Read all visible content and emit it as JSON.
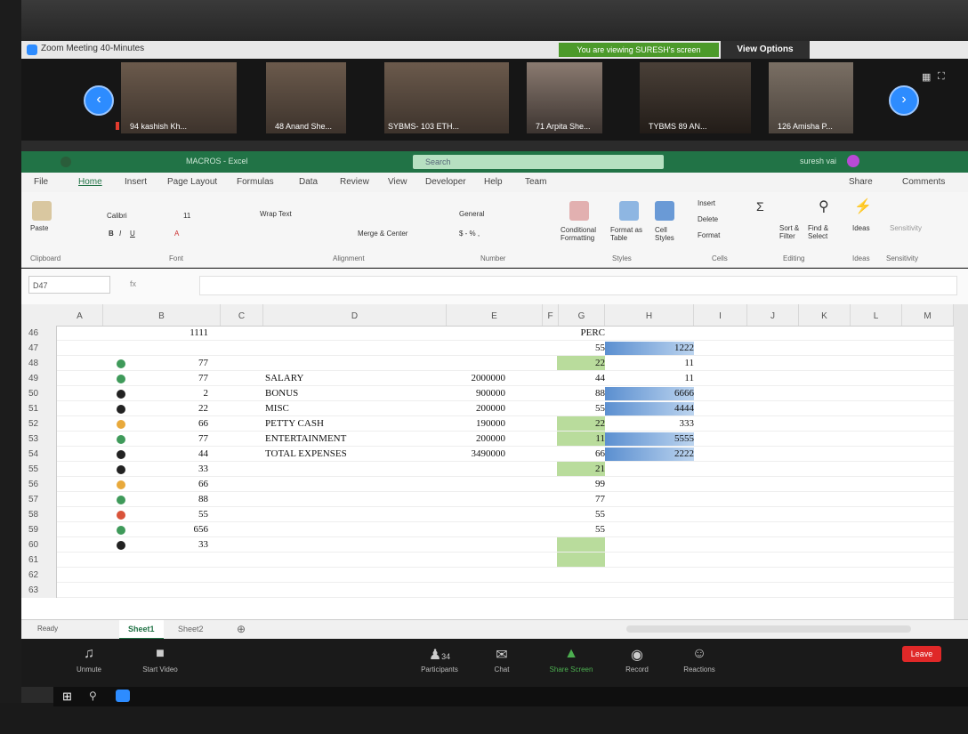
{
  "zoom": {
    "window_title": "Zoom Meeting 40-Minutes",
    "viewing_banner": "You are viewing SURESH's screen",
    "view_options": "View Options",
    "participants": [
      {
        "name": "94 kashish Kh..."
      },
      {
        "name": "48 Anand She..."
      },
      {
        "name": "SYBMS- 103 ETH..."
      },
      {
        "name": "71 Arpita She..."
      },
      {
        "name": "TYBMS 89 AN..."
      },
      {
        "name": "126 Amisha P..."
      }
    ],
    "toolbar": [
      {
        "label": "Unmute",
        "icon": "microphone-icon"
      },
      {
        "label": "Start Video",
        "icon": "video-camera-icon"
      },
      {
        "label": "Participants",
        "icon": "participants-icon"
      },
      {
        "label": "Chat",
        "icon": "chat-icon"
      },
      {
        "label": "Share Screen",
        "icon": "share-screen-icon"
      },
      {
        "label": "Record",
        "icon": "record-icon"
      },
      {
        "label": "Reactions",
        "icon": "reactions-icon"
      }
    ],
    "participants_count": "34",
    "leave_label": "Leave"
  },
  "excel": {
    "file_name": "MACROS - Excel",
    "search_placeholder": "Search",
    "user": "suresh vai",
    "tabs": [
      "File",
      "Home",
      "Insert",
      "Page Layout",
      "Formulas",
      "Data",
      "Review",
      "View",
      "Developer",
      "Help",
      "Team"
    ],
    "active_tab": "Home",
    "share_label": "Share",
    "comments_label": "Comments",
    "ribbon": {
      "paste": "Paste",
      "font_name": "Calibri",
      "font_size": "11",
      "wrap_text": "Wrap Text",
      "merge_center": "Merge & Center",
      "number_format": "General",
      "conditional_formatting": "Conditional Formatting",
      "format_as_table": "Format as Table",
      "cell_styles": "Cell Styles",
      "insert": "Insert",
      "delete": "Delete",
      "format": "Format",
      "sort_filter": "Sort & Filter",
      "find_select": "Find & Select",
      "ideas": "Ideas",
      "sensitivity": "Sensitivity",
      "groups": [
        "Clipboard",
        "Font",
        "Alignment",
        "Number",
        "Styles",
        "Cells",
        "Editing",
        "Ideas",
        "Sensitivity"
      ]
    },
    "name_box": "D47",
    "fx": "fx",
    "columns": [
      "A",
      "B",
      "C",
      "D",
      "E",
      "F",
      "G",
      "H",
      "I",
      "J",
      "K",
      "L",
      "M"
    ],
    "rows": [
      {
        "n": "46",
        "b": "1111",
        "dot": "",
        "d": "",
        "e": "",
        "g": "PERC",
        "g_fill": false,
        "h": "",
        "h_bar": 0
      },
      {
        "n": "47",
        "b": "",
        "dot": "",
        "d": "",
        "e": "",
        "g": "55",
        "g_fill": false,
        "h": "1222",
        "h_bar": 1.0
      },
      {
        "n": "48",
        "b": "77",
        "dot": "#3f9a5a",
        "d": "",
        "e": "",
        "g": "22",
        "g_fill": true,
        "h": "11",
        "h_bar": 0
      },
      {
        "n": "49",
        "b": "77",
        "dot": "#3f9a5a",
        "d": "SALARY",
        "e": "2000000",
        "g": "44",
        "g_fill": false,
        "h": "11",
        "h_bar": 0
      },
      {
        "n": "50",
        "b": "2",
        "dot": "#222222",
        "d": "BONUS",
        "e": "900000",
        "g": "88",
        "g_fill": false,
        "h": "6666",
        "h_bar": 1.0
      },
      {
        "n": "51",
        "b": "22",
        "dot": "#222222",
        "d": "MISC",
        "e": "200000",
        "g": "55",
        "g_fill": false,
        "h": "4444",
        "h_bar": 1.0
      },
      {
        "n": "52",
        "b": "66",
        "dot": "#e8a93b",
        "d": "PETTY CASH",
        "e": "190000",
        "g": "22",
        "g_fill": true,
        "h": "333",
        "h_bar": 0
      },
      {
        "n": "53",
        "b": "77",
        "dot": "#3f9a5a",
        "d": "ENTERTAINMENT",
        "e": "200000",
        "g": "11",
        "g_fill": true,
        "h": "5555",
        "h_bar": 1.0
      },
      {
        "n": "54",
        "b": "44",
        "dot": "#222222",
        "d": "TOTAL EXPENSES",
        "e": "3490000",
        "g": "66",
        "g_fill": false,
        "h": "2222",
        "h_bar": 1.0
      },
      {
        "n": "55",
        "b": "33",
        "dot": "#222222",
        "d": "",
        "e": "",
        "g": "21",
        "g_fill": true,
        "h": "",
        "h_bar": 0
      },
      {
        "n": "56",
        "b": "66",
        "dot": "#e8a93b",
        "d": "",
        "e": "",
        "g": "99",
        "g_fill": false,
        "h": "",
        "h_bar": 0
      },
      {
        "n": "57",
        "b": "88",
        "dot": "#3f9a5a",
        "d": "",
        "e": "",
        "g": "77",
        "g_fill": false,
        "h": "",
        "h_bar": 0
      },
      {
        "n": "58",
        "b": "55",
        "dot": "#d9533a",
        "d": "",
        "e": "",
        "g": "55",
        "g_fill": false,
        "h": "",
        "h_bar": 0
      },
      {
        "n": "59",
        "b": "656",
        "dot": "#3f9a5a",
        "d": "",
        "e": "",
        "g": "55",
        "g_fill": false,
        "h": "",
        "h_bar": 0
      },
      {
        "n": "60",
        "b": "33",
        "dot": "#222222",
        "d": "",
        "e": "",
        "g": "",
        "g_fill": true,
        "h": "",
        "h_bar": 0
      },
      {
        "n": "61",
        "b": "",
        "dot": "",
        "d": "",
        "e": "",
        "g": "",
        "g_fill": true,
        "h": "",
        "h_bar": 0
      },
      {
        "n": "62",
        "b": "",
        "dot": "",
        "d": "",
        "e": "",
        "g": "",
        "g_fill": false,
        "h": "",
        "h_bar": 0
      },
      {
        "n": "63",
        "b": "",
        "dot": "",
        "d": "",
        "e": "",
        "g": "",
        "g_fill": false,
        "h": "",
        "h_bar": 0
      }
    ],
    "sheets": [
      "Sheet1",
      "Sheet2"
    ],
    "active_sheet": "Sheet1",
    "status": "Ready"
  },
  "colors": {
    "excel_green": "#217346",
    "zoom_blue": "#2d8cff",
    "green_fill": "#b9dc9c",
    "databar_blue": "#5b8fd0"
  }
}
